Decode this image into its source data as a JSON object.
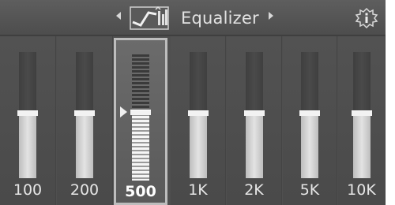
{
  "title": "Equalizer",
  "icons": {
    "left": "chevron-left",
    "right": "chevron-right",
    "equalizer": "equalizer-graph",
    "info": "info"
  },
  "bands": [
    {
      "label": "100",
      "level": 0.52,
      "selected": false
    },
    {
      "label": "200",
      "level": 0.52,
      "selected": false
    },
    {
      "label": "500",
      "level": 0.52,
      "selected": true
    },
    {
      "label": "1K",
      "level": 0.52,
      "selected": false
    },
    {
      "label": "2K",
      "level": 0.52,
      "selected": false
    },
    {
      "label": "5K",
      "level": 0.52,
      "selected": false
    },
    {
      "label": "10K",
      "level": 0.52,
      "selected": false
    }
  ]
}
